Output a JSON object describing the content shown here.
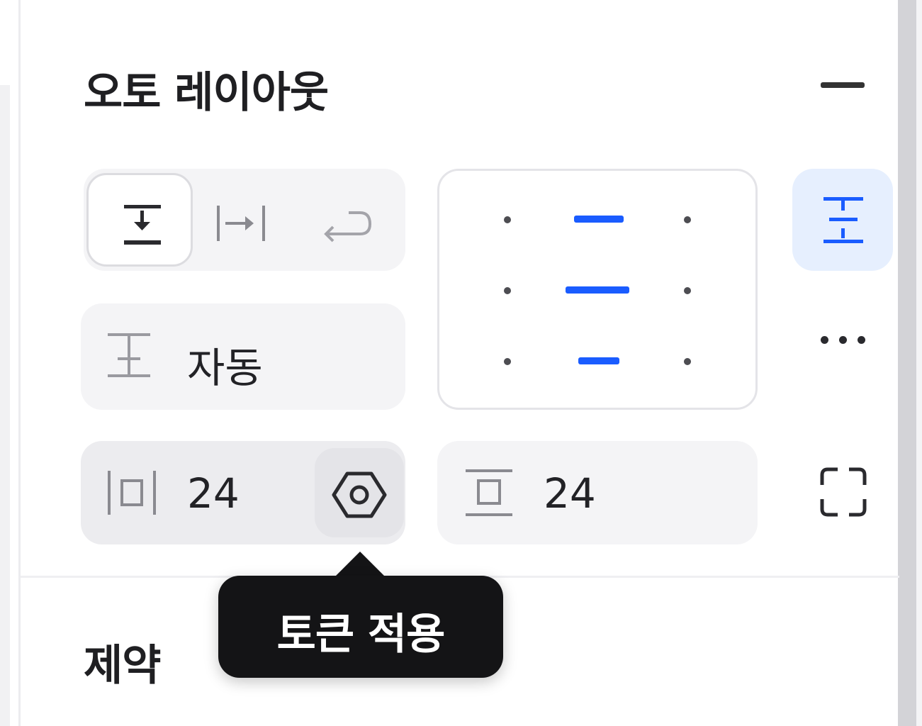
{
  "auto_layout": {
    "title": "오토 레이아웃",
    "collapse_icon": "minus-icon",
    "direction": {
      "options": [
        {
          "icon": "vertical-direction-icon",
          "selected": true
        },
        {
          "icon": "horizontal-direction-icon",
          "selected": false
        },
        {
          "icon": "wrap-icon",
          "selected": false
        }
      ]
    },
    "size": {
      "icon": "vertical-resize-icon",
      "value": "자동"
    },
    "alignment": {
      "selected_column": "center",
      "icon": "alignment-grid"
    },
    "distribute_icon": "distribute-vertical-icon",
    "more_icon": "more-horizontal-icon",
    "horizontal_padding": {
      "icon": "horizontal-padding-icon",
      "value": "24",
      "token_icon": "token-hexagon-icon"
    },
    "vertical_padding": {
      "icon": "vertical-padding-icon",
      "value": "24"
    },
    "clip_icon": "clip-content-icon"
  },
  "tooltip": {
    "text": "토큰 적용"
  },
  "constraints": {
    "title": "제약"
  },
  "colors": {
    "accent": "#1a5cff",
    "accent_bg": "#e6effe",
    "field_bg": "#f4f4f6",
    "tooltip_bg": "#141416"
  }
}
